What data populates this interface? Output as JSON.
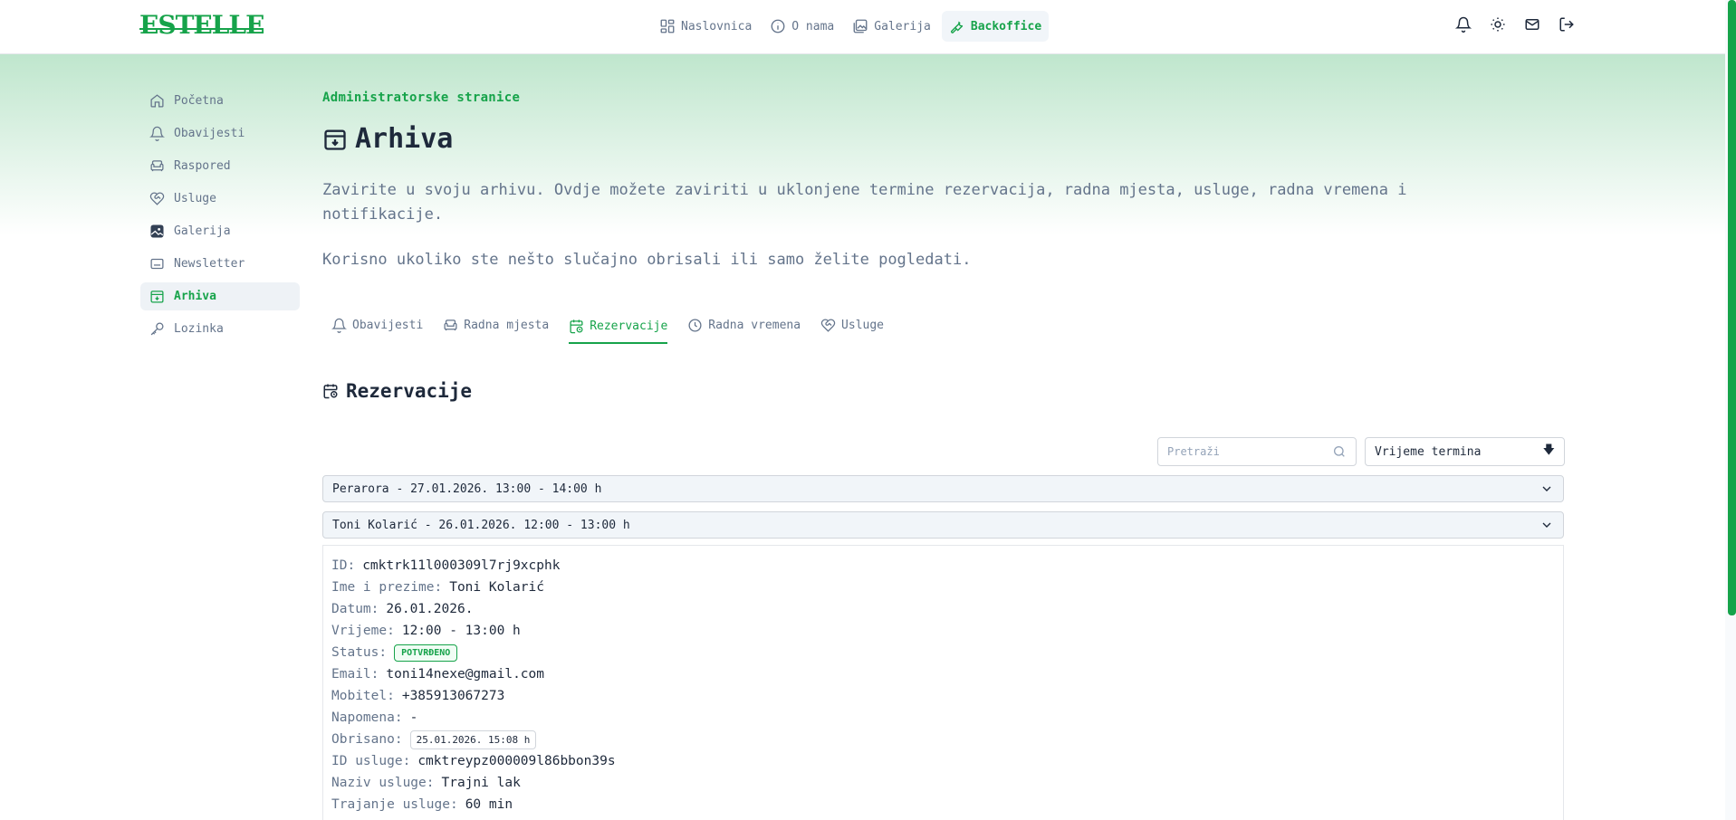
{
  "brand": {
    "logo_text": "ESTELLE"
  },
  "topnav": {
    "items": [
      {
        "label": "Naslovnica",
        "icon": "layout-icon"
      },
      {
        "label": "O nama",
        "icon": "info-icon"
      },
      {
        "label": "Galerija",
        "icon": "gallery-icon"
      },
      {
        "label": "Backoffice",
        "icon": "wrench-icon",
        "active": true
      }
    ]
  },
  "top_actions": [
    "bell-icon",
    "sun-icon",
    "mail-icon",
    "logout-icon"
  ],
  "sidebar": {
    "items": [
      {
        "label": "Početna",
        "icon": "home-icon"
      },
      {
        "label": "Obavijesti",
        "icon": "bell-icon"
      },
      {
        "label": "Raspored",
        "icon": "armchair-icon"
      },
      {
        "label": "Usluge",
        "icon": "heart-handshake-icon"
      },
      {
        "label": "Galerija",
        "icon": "image-icon"
      },
      {
        "label": "Newsletter",
        "icon": "newsletter-icon"
      },
      {
        "label": "Arhiva",
        "icon": "archive-icon",
        "active": true
      },
      {
        "label": "Lozinka",
        "icon": "key-icon"
      }
    ]
  },
  "page": {
    "kicker": "Administratorske stranice",
    "title": "Arhiva",
    "description": "Zavirite u svoju arhivu. Ovdje možete zaviriti u uklonjene termine rezervacija, radna mjesta, usluge, radna vremena i notifikacije.",
    "description2": "Korisno ukoliko ste nešto slučajno obrisali ili samo želite pogledati."
  },
  "tabs": [
    {
      "label": "Obavijesti",
      "icon": "bell-icon"
    },
    {
      "label": "Radna mjesta",
      "icon": "armchair-icon"
    },
    {
      "label": "Rezervacije",
      "icon": "calendar-clock-icon",
      "active": true
    },
    {
      "label": "Radna vremena",
      "icon": "clock-icon"
    },
    {
      "label": "Usluge",
      "icon": "heart-handshake-icon"
    }
  ],
  "section": {
    "title": "Rezervacije"
  },
  "search": {
    "placeholder": "Pretraži"
  },
  "sort": {
    "label": "Vrijeme termina",
    "arrow": "🡇"
  },
  "reservations": [
    {
      "summary": "Perarora - 27.01.2026. 13:00 - 14:00 h"
    },
    {
      "summary": "Toni Kolarić - 26.01.2026. 12:00 - 13:00 h"
    }
  ],
  "details": {
    "id_label": "ID:",
    "id_value": "cmktrk11l000309l7rj9xcphk",
    "name_label": "Ime i prezime:",
    "name_value": "Toni Kolarić",
    "date_label": "Datum:",
    "date_value": "26.01.2026.",
    "time_label": "Vrijeme:",
    "time_value": "12:00 - 13:00 h",
    "status_label": "Status:",
    "status_value": "POTVRĐENO",
    "email_label": "Email:",
    "email_value": "toni14nexe@gmail.com",
    "phone_label": "Mobitel:",
    "phone_value": "+385913067273",
    "note_label": "Napomena:",
    "note_value": "-",
    "deleted_label": "Obrisano:",
    "deleted_value": "25.01.2026. 15:08 h",
    "service_id_label": "ID usluge:",
    "service_id_value": "cmktreypz000009l86bbon39s",
    "service_name_label": "Naziv usluge:",
    "service_name_value": "Trajni lak",
    "service_duration_label": "Trajanje usluge:",
    "service_duration_value": "60 min"
  },
  "colors": {
    "accent": "#16a34a",
    "text": "#334155",
    "muted": "#64748b"
  }
}
